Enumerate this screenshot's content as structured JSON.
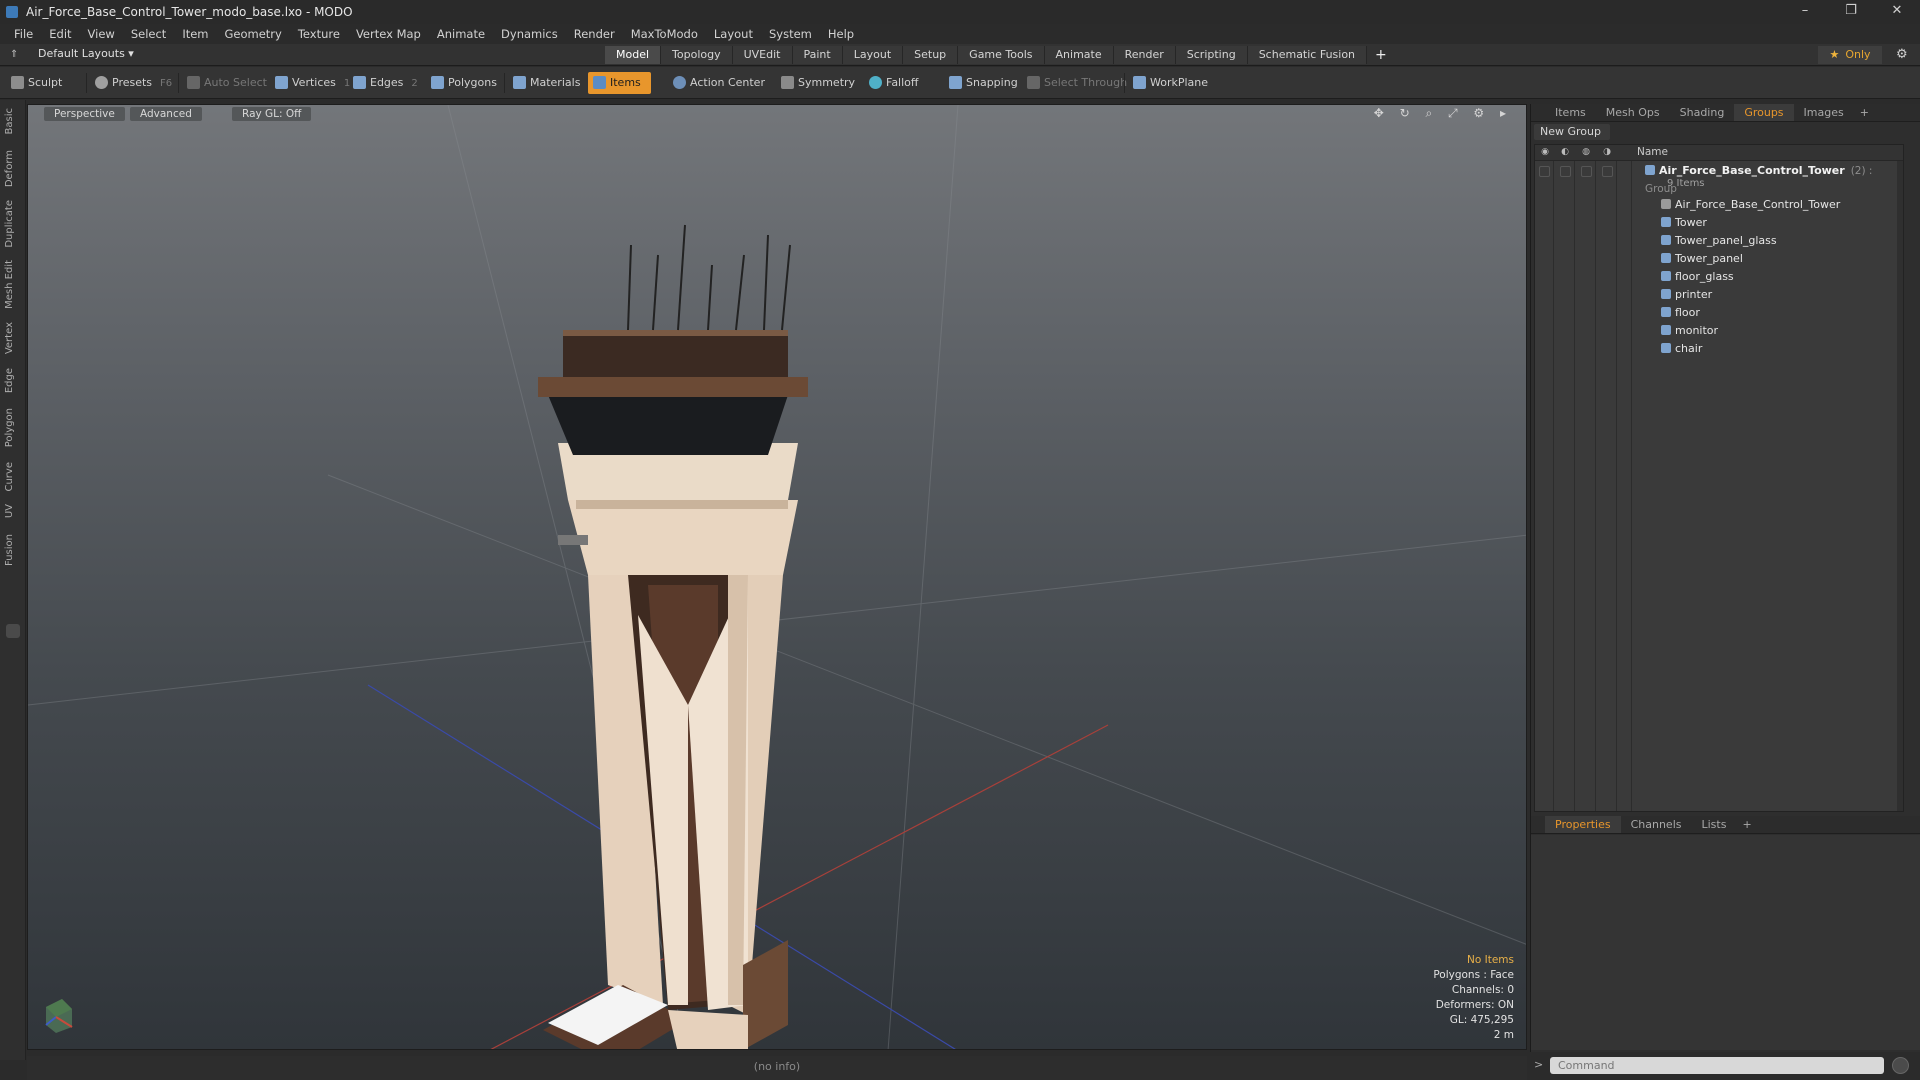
{
  "window": {
    "title": "Air_Force_Base_Control_Tower_modo_base.lxo - MODO",
    "controls": [
      "–",
      "❐",
      "✕"
    ]
  },
  "menu": [
    "File",
    "Edit",
    "View",
    "Select",
    "Item",
    "Geometry",
    "Texture",
    "Vertex Map",
    "Animate",
    "Dynamics",
    "Render",
    "MaxToModo",
    "Layout",
    "System",
    "Help"
  ],
  "layoutbar": {
    "layouts_label": "Default Layouts ▾",
    "tabs": [
      "Model",
      "Topology",
      "UVEdit",
      "Paint",
      "Layout",
      "Setup",
      "Game Tools",
      "Animate",
      "Render",
      "Scripting",
      "Schematic Fusion"
    ],
    "active_tab": "Model",
    "plus": "+",
    "only_label": "Only",
    "only_star": "★"
  },
  "toolbar": {
    "sculpt": "Sculpt",
    "presets": "Presets",
    "presets_key": "F6",
    "auto_select": "Auto Select",
    "vertices": "Vertices",
    "vertices_key": "1",
    "edges": "Edges",
    "edges_key": "2",
    "polygons": "Polygons",
    "materials": "Materials",
    "items": "Items",
    "action_center": "Action Center",
    "symmetry": "Symmetry",
    "falloff": "Falloff",
    "snapping": "Snapping",
    "select_through": "Select Through",
    "workplane": "WorkPlane"
  },
  "left_tabs": [
    "Basic",
    "Deform",
    "Duplicate",
    "Mesh Edit",
    "Vertex",
    "Edge",
    "Polygon",
    "Curve",
    "UV",
    "Fusion"
  ],
  "viewport": {
    "view": "Perspective",
    "shading": "Advanced",
    "raygl": "Ray GL: Off",
    "icons": "✥ ↻ ⌕ ⤢ ⚙ ▸",
    "hud": {
      "selection": "No Items",
      "polygons": "Polygons : Face",
      "channels": "Channels: 0",
      "deformers": "Deformers: ON",
      "gl": "GL: 475,295",
      "scale": "2 m"
    }
  },
  "infobar": "(no info)",
  "right_panel": {
    "tabs": [
      "Items",
      "Mesh Ops",
      "Shading",
      "Groups",
      "Images"
    ],
    "active_tab": "Groups",
    "plus": "+",
    "new_group": "New Group",
    "col_name": "Name",
    "group": {
      "name": "Air_Force_Base_Control_Tower",
      "suffix": "(2) : Group",
      "count": "9 Items",
      "children": [
        "Air_Force_Base_Control_Tower",
        "Tower",
        "Tower_panel_glass",
        "Tower_panel",
        "floor_glass",
        "printer",
        "floor",
        "monitor",
        "chair"
      ]
    },
    "props_tabs": [
      "Properties",
      "Channels",
      "Lists"
    ],
    "props_active": "Properties",
    "command_placeholder": "Command"
  },
  "colors": {
    "accent": "#e8962c",
    "viewport_top": "#73767a",
    "viewport_bottom": "#30353a",
    "panel": "#3a3a3a"
  }
}
